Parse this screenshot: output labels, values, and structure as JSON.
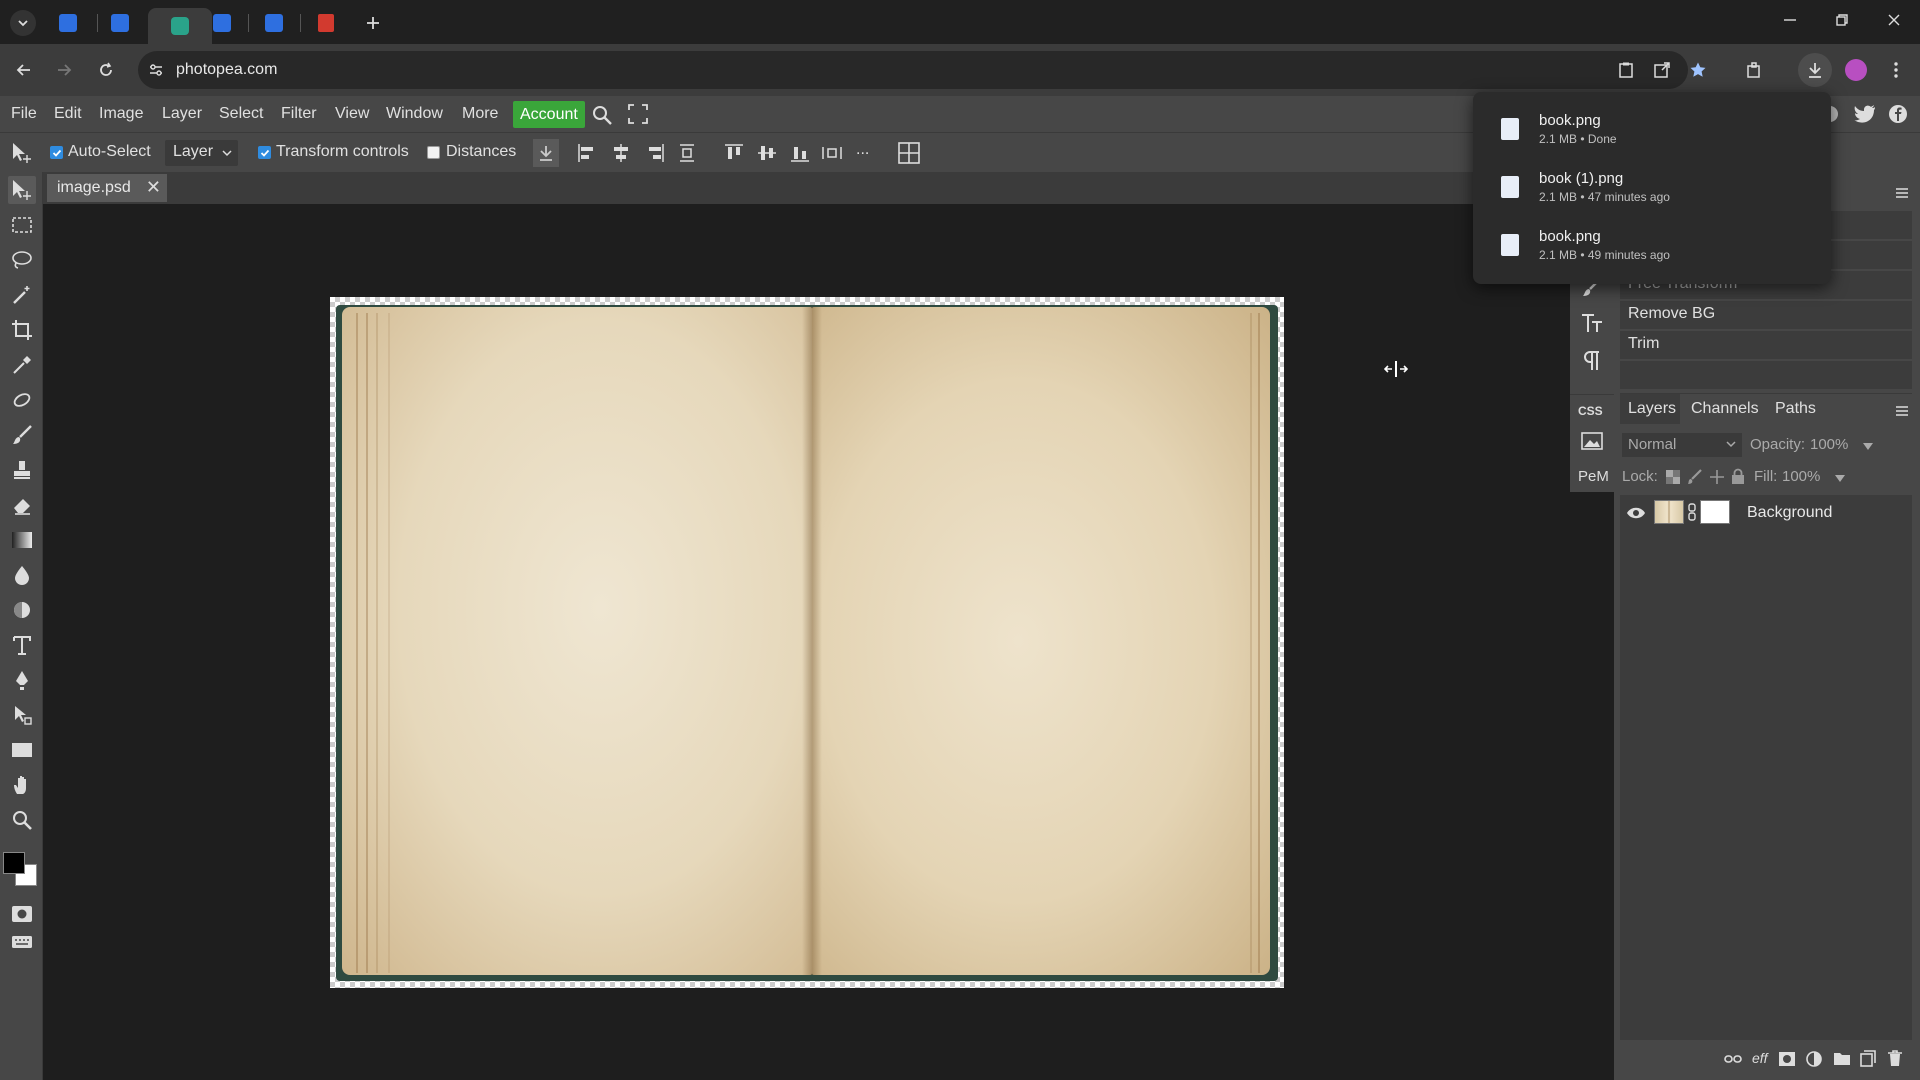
{
  "browser": {
    "url": "photopea.com",
    "tabs": [
      {
        "icon": "photopea-favicon",
        "active": false
      },
      {
        "icon": "photopea-favicon",
        "active": false
      },
      {
        "icon": "green-app-favicon",
        "active": true
      },
      {
        "icon": "photopea-favicon",
        "active": false
      },
      {
        "icon": "photopea-favicon",
        "active": false
      },
      {
        "icon": "red-app-favicon",
        "active": false
      }
    ]
  },
  "downloads": {
    "items": [
      {
        "name": "book.png",
        "meta": "2.1 MB • Done"
      },
      {
        "name": "book (1).png",
        "meta": "2.1 MB • 47 minutes ago"
      },
      {
        "name": "book.png",
        "meta": "2.1 MB • 49 minutes ago"
      }
    ]
  },
  "menu": {
    "items": [
      "File",
      "Edit",
      "Image",
      "Layer",
      "Select",
      "Filter",
      "View",
      "Window",
      "More"
    ],
    "account": "Account"
  },
  "options": {
    "auto_select": "Auto-Select",
    "layer_select": "Layer",
    "transform_controls": "Transform controls",
    "distances": "Distances",
    "more": "..."
  },
  "document": {
    "tab_title": "image.psd",
    "close": "✕"
  },
  "minibar": {
    "css": "CSS",
    "pem": "PeM"
  },
  "history_panel": {
    "items": [
      "Free Transform",
      "Remove BG",
      "Trim"
    ]
  },
  "layers_panel": {
    "tabs": [
      "Layers",
      "Channels",
      "Paths"
    ],
    "blend_mode": "Normal",
    "opacity_label": "Opacity:",
    "opacity_value": "100%",
    "lock_label": "Lock:",
    "fill_label": "Fill:",
    "fill_value": "100%",
    "layers": [
      {
        "name": "Background"
      }
    ]
  },
  "colors": {
    "accent": "#3aa63a",
    "foreground": "#000000",
    "background": "#ffffff"
  }
}
